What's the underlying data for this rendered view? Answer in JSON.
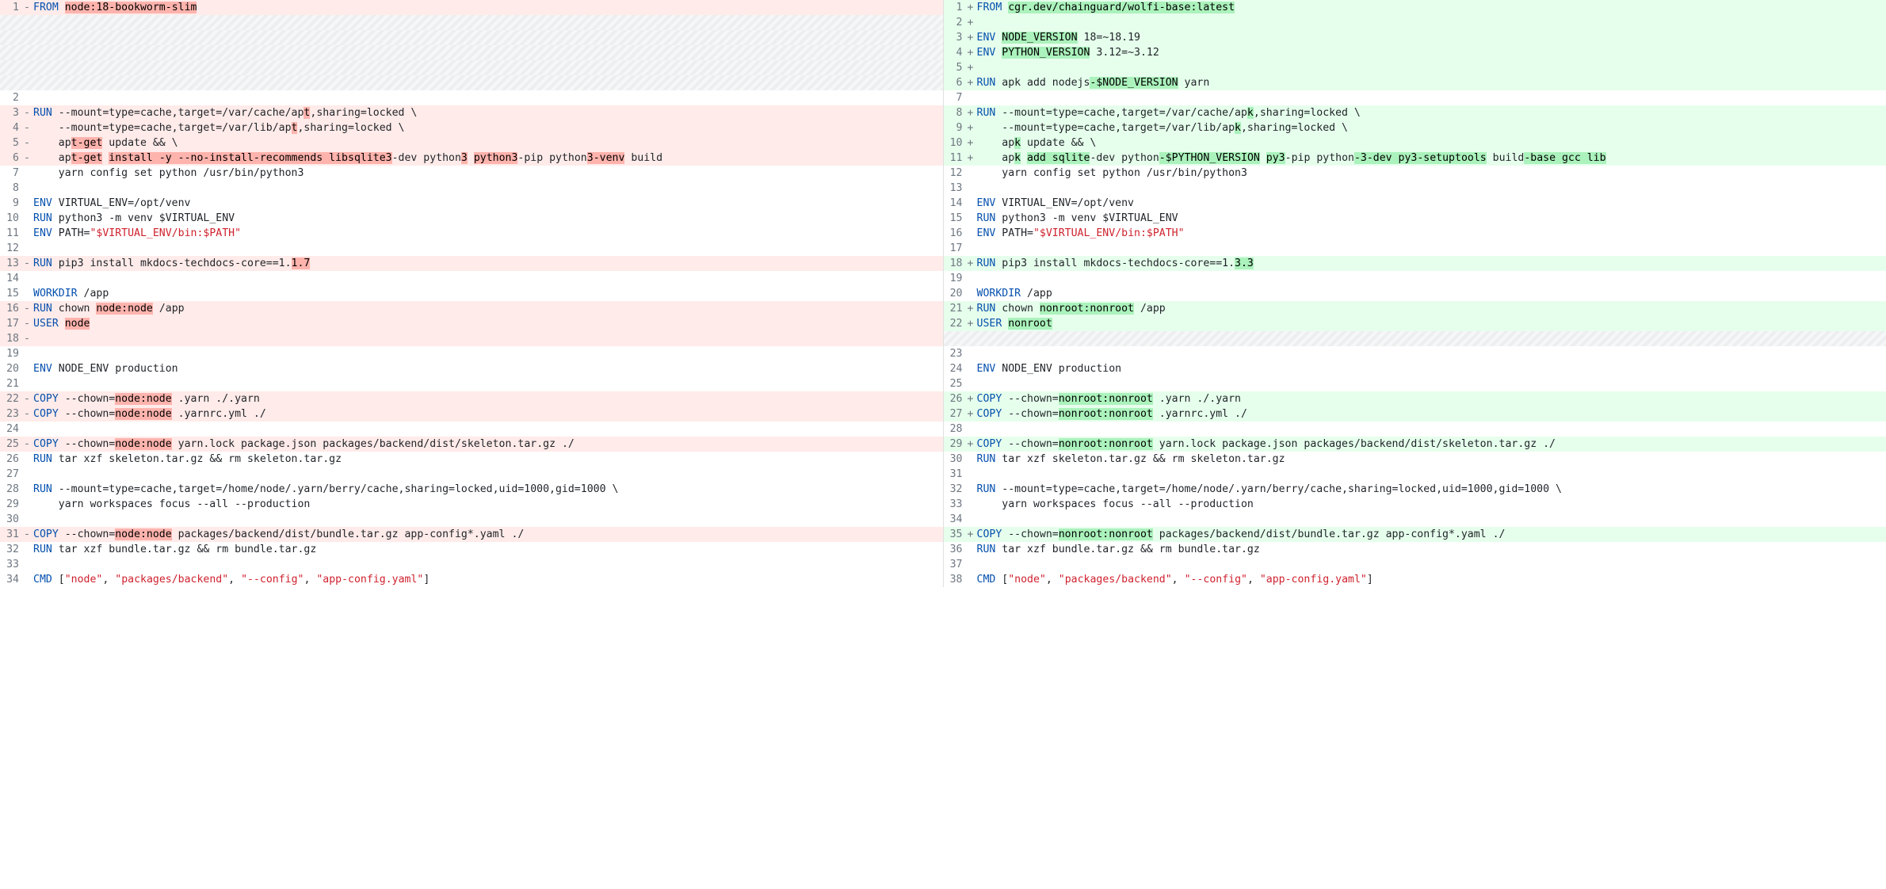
{
  "left": [
    {
      "n": 1,
      "type": "del",
      "tokens": [
        [
          "kw",
          "FROM"
        ],
        [
          "cmd",
          " "
        ],
        [
          "hl-del",
          "node:18-bookworm-slim"
        ]
      ]
    },
    {
      "type": "placeholder"
    },
    {
      "type": "placeholder"
    },
    {
      "type": "placeholder"
    },
    {
      "type": "placeholder"
    },
    {
      "type": "placeholder"
    },
    {
      "n": 2,
      "type": "ctx",
      "tokens": []
    },
    {
      "n": 3,
      "type": "del",
      "tokens": [
        [
          "kw",
          "RUN"
        ],
        [
          "cmd",
          " --mount=type=cache,target=/var/cache/ap"
        ],
        [
          "hl-del",
          "t"
        ],
        [
          "cmd",
          ",sharing=locked \\"
        ]
      ]
    },
    {
      "n": 4,
      "type": "del",
      "tokens": [
        [
          "cmd",
          "    --mount=type=cache,target=/var/lib/ap"
        ],
        [
          "hl-del",
          "t"
        ],
        [
          "cmd",
          ",sharing=locked \\"
        ]
      ]
    },
    {
      "n": 5,
      "type": "del",
      "tokens": [
        [
          "cmd",
          "    ap"
        ],
        [
          "hl-del",
          "t-get"
        ],
        [
          "cmd",
          " update && \\"
        ]
      ]
    },
    {
      "n": 6,
      "type": "del",
      "tokens": [
        [
          "cmd",
          "    ap"
        ],
        [
          "hl-del",
          "t-get"
        ],
        [
          "cmd",
          " "
        ],
        [
          "hl-del",
          "install -y --no-install-recommends libsqlite3"
        ],
        [
          "cmd",
          "-dev python"
        ],
        [
          "hl-del",
          "3"
        ],
        [
          "cmd",
          " "
        ],
        [
          "hl-del",
          "python3"
        ],
        [
          "cmd",
          "-pip python"
        ],
        [
          "hl-del",
          "3-venv"
        ],
        [
          "cmd",
          " build"
        ]
      ]
    },
    {
      "n": 7,
      "type": "ctx",
      "tokens": [
        [
          "cmd",
          "    yarn config set python /usr/bin/python3"
        ]
      ]
    },
    {
      "n": 8,
      "type": "ctx",
      "tokens": []
    },
    {
      "n": 9,
      "type": "ctx",
      "tokens": [
        [
          "kw",
          "ENV"
        ],
        [
          "cmd",
          " VIRTUAL_ENV=/opt/venv"
        ]
      ]
    },
    {
      "n": 10,
      "type": "ctx",
      "tokens": [
        [
          "kw",
          "RUN"
        ],
        [
          "cmd",
          " python3 -m venv $VIRTUAL_ENV"
        ]
      ]
    },
    {
      "n": 11,
      "type": "ctx",
      "tokens": [
        [
          "kw",
          "ENV"
        ],
        [
          "cmd",
          " PATH="
        ],
        [
          "str",
          "\"$VIRTUAL_ENV"
        ],
        [
          "str",
          "/bin:"
        ],
        [
          "str",
          "$PATH\""
        ]
      ]
    },
    {
      "n": 12,
      "type": "ctx",
      "tokens": []
    },
    {
      "n": 13,
      "type": "del",
      "tokens": [
        [
          "kw",
          "RUN"
        ],
        [
          "cmd",
          " pip3 install mkdocs-techdocs-core==1."
        ],
        [
          "hl-del",
          "1.7"
        ]
      ]
    },
    {
      "n": 14,
      "type": "ctx",
      "tokens": []
    },
    {
      "n": 15,
      "type": "ctx",
      "tokens": [
        [
          "kw",
          "WORKDIR"
        ],
        [
          "cmd",
          " /app"
        ]
      ]
    },
    {
      "n": 16,
      "type": "del",
      "tokens": [
        [
          "kw",
          "RUN"
        ],
        [
          "cmd",
          " chown "
        ],
        [
          "hl-del",
          "node:node"
        ],
        [
          "cmd",
          " /app"
        ]
      ]
    },
    {
      "n": 17,
      "type": "del",
      "tokens": [
        [
          "kw",
          "USER"
        ],
        [
          "cmd",
          " "
        ],
        [
          "hl-del",
          "node"
        ]
      ]
    },
    {
      "n": 18,
      "type": "del",
      "tokens": []
    },
    {
      "n": 19,
      "type": "ctx",
      "tokens": []
    },
    {
      "n": 20,
      "type": "ctx",
      "tokens": [
        [
          "kw",
          "ENV"
        ],
        [
          "cmd",
          " NODE_ENV production"
        ]
      ]
    },
    {
      "n": 21,
      "type": "ctx",
      "tokens": []
    },
    {
      "n": 22,
      "type": "del",
      "tokens": [
        [
          "kw",
          "COPY"
        ],
        [
          "cmd",
          " --chown="
        ],
        [
          "hl-del",
          "node:node"
        ],
        [
          "cmd",
          " .yarn ./.yarn"
        ]
      ]
    },
    {
      "n": 23,
      "type": "del",
      "tokens": [
        [
          "kw",
          "COPY"
        ],
        [
          "cmd",
          " --chown="
        ],
        [
          "hl-del",
          "node:node"
        ],
        [
          "cmd",
          " .yarnrc.yml ./"
        ]
      ]
    },
    {
      "n": 24,
      "type": "ctx",
      "tokens": []
    },
    {
      "n": 25,
      "type": "del",
      "tokens": [
        [
          "kw",
          "COPY"
        ],
        [
          "cmd",
          " --chown="
        ],
        [
          "hl-del",
          "node:node"
        ],
        [
          "cmd",
          " yarn.lock package.json packages/backend/dist/skeleton.tar.gz ./"
        ]
      ]
    },
    {
      "n": 26,
      "type": "ctx",
      "tokens": [
        [
          "kw",
          "RUN"
        ],
        [
          "cmd",
          " tar xzf skeleton.tar.gz && rm skeleton.tar.gz"
        ]
      ]
    },
    {
      "n": 27,
      "type": "ctx",
      "tokens": []
    },
    {
      "n": 28,
      "type": "ctx",
      "tokens": [
        [
          "kw",
          "RUN"
        ],
        [
          "cmd",
          " --mount=type=cache,target=/home/node/.yarn/berry/cache,sharing=locked,uid=1000,gid=1000 \\"
        ]
      ]
    },
    {
      "n": 29,
      "type": "ctx",
      "tokens": [
        [
          "cmd",
          "    yarn workspaces focus --all --production"
        ]
      ]
    },
    {
      "n": 30,
      "type": "ctx",
      "tokens": []
    },
    {
      "n": 31,
      "type": "del",
      "tokens": [
        [
          "kw",
          "COPY"
        ],
        [
          "cmd",
          " --chown="
        ],
        [
          "hl-del",
          "node:node"
        ],
        [
          "cmd",
          " packages/backend/dist/bundle.tar.gz app-config*.yaml ./"
        ]
      ]
    },
    {
      "n": 32,
      "type": "ctx",
      "tokens": [
        [
          "kw",
          "RUN"
        ],
        [
          "cmd",
          " tar xzf bundle.tar.gz && rm bundle.tar.gz"
        ]
      ]
    },
    {
      "n": 33,
      "type": "ctx",
      "tokens": []
    },
    {
      "n": 34,
      "type": "ctx",
      "tokens": [
        [
          "kw",
          "CMD"
        ],
        [
          "cmd",
          " ["
        ],
        [
          "str",
          "\"node\""
        ],
        [
          "cmd",
          ", "
        ],
        [
          "str",
          "\"packages/backend\""
        ],
        [
          "cmd",
          ", "
        ],
        [
          "str",
          "\"--config\""
        ],
        [
          "cmd",
          ", "
        ],
        [
          "str",
          "\"app-config.yaml\""
        ],
        [
          "cmd",
          "]"
        ]
      ]
    }
  ],
  "right": [
    {
      "n": 1,
      "type": "add",
      "tokens": [
        [
          "kw",
          "FROM"
        ],
        [
          "cmd",
          " "
        ],
        [
          "hl-add",
          "cgr.dev/chainguard/wolfi-base:latest"
        ]
      ]
    },
    {
      "n": 2,
      "type": "add",
      "tokens": []
    },
    {
      "n": 3,
      "type": "add",
      "tokens": [
        [
          "kw",
          "ENV"
        ],
        [
          "cmd",
          " "
        ],
        [
          "hl-add",
          "NODE_VERSION"
        ],
        [
          "cmd",
          " 18=~18.19"
        ]
      ]
    },
    {
      "n": 4,
      "type": "add",
      "tokens": [
        [
          "kw",
          "ENV"
        ],
        [
          "cmd",
          " "
        ],
        [
          "hl-add",
          "PYTHON_VERSION"
        ],
        [
          "cmd",
          " 3.12=~3.12"
        ]
      ]
    },
    {
      "n": 5,
      "type": "add",
      "tokens": []
    },
    {
      "n": 6,
      "type": "add",
      "tokens": [
        [
          "kw",
          "RUN"
        ],
        [
          "cmd",
          " apk add nodejs"
        ],
        [
          "hl-add",
          "-$NODE_VERSION"
        ],
        [
          "cmd",
          " yarn"
        ]
      ]
    },
    {
      "n": 7,
      "type": "ctx",
      "tokens": []
    },
    {
      "n": 8,
      "type": "add",
      "tokens": [
        [
          "kw",
          "RUN"
        ],
        [
          "cmd",
          " --mount=type=cache,target=/var/cache/ap"
        ],
        [
          "hl-add",
          "k"
        ],
        [
          "cmd",
          ",sharing=locked \\"
        ]
      ]
    },
    {
      "n": 9,
      "type": "add",
      "tokens": [
        [
          "cmd",
          "    --mount=type=cache,target=/var/lib/ap"
        ],
        [
          "hl-add",
          "k"
        ],
        [
          "cmd",
          ",sharing=locked \\"
        ]
      ]
    },
    {
      "n": 10,
      "type": "add",
      "tokens": [
        [
          "cmd",
          "    ap"
        ],
        [
          "hl-add",
          "k"
        ],
        [
          "cmd",
          " update && \\"
        ]
      ]
    },
    {
      "n": 11,
      "type": "add",
      "tokens": [
        [
          "cmd",
          "    ap"
        ],
        [
          "hl-add",
          "k"
        ],
        [
          "cmd",
          " "
        ],
        [
          "hl-add",
          "add sqlite"
        ],
        [
          "cmd",
          "-dev python"
        ],
        [
          "hl-add",
          "-$PYTHON_VERSION"
        ],
        [
          "cmd",
          " "
        ],
        [
          "hl-add",
          "py3"
        ],
        [
          "cmd",
          "-pip python"
        ],
        [
          "hl-add",
          "-3-dev py3-setuptools"
        ],
        [
          "cmd",
          " build"
        ],
        [
          "hl-add",
          "-base gcc lib"
        ]
      ]
    },
    {
      "n": 12,
      "type": "ctx",
      "tokens": [
        [
          "cmd",
          "    yarn config set python /usr/bin/python3"
        ]
      ]
    },
    {
      "n": 13,
      "type": "ctx",
      "tokens": []
    },
    {
      "n": 14,
      "type": "ctx",
      "tokens": [
        [
          "kw",
          "ENV"
        ],
        [
          "cmd",
          " VIRTUAL_ENV=/opt/venv"
        ]
      ]
    },
    {
      "n": 15,
      "type": "ctx",
      "tokens": [
        [
          "kw",
          "RUN"
        ],
        [
          "cmd",
          " python3 -m venv $VIRTUAL_ENV"
        ]
      ]
    },
    {
      "n": 16,
      "type": "ctx",
      "tokens": [
        [
          "kw",
          "ENV"
        ],
        [
          "cmd",
          " PATH="
        ],
        [
          "str",
          "\"$VIRTUAL_ENV"
        ],
        [
          "str",
          "/bin:"
        ],
        [
          "str",
          "$PATH\""
        ]
      ]
    },
    {
      "n": 17,
      "type": "ctx",
      "tokens": []
    },
    {
      "n": 18,
      "type": "add",
      "tokens": [
        [
          "kw",
          "RUN"
        ],
        [
          "cmd",
          " pip3 install mkdocs-techdocs-core==1."
        ],
        [
          "hl-add",
          "3.3"
        ]
      ]
    },
    {
      "n": 19,
      "type": "ctx",
      "tokens": []
    },
    {
      "n": 20,
      "type": "ctx",
      "tokens": [
        [
          "kw",
          "WORKDIR"
        ],
        [
          "cmd",
          " /app"
        ]
      ]
    },
    {
      "n": 21,
      "type": "add",
      "tokens": [
        [
          "kw",
          "RUN"
        ],
        [
          "cmd",
          " chown "
        ],
        [
          "hl-add",
          "nonroot:nonroot"
        ],
        [
          "cmd",
          " /app"
        ]
      ]
    },
    {
      "n": 22,
      "type": "add",
      "tokens": [
        [
          "kw",
          "USER"
        ],
        [
          "cmd",
          " "
        ],
        [
          "hl-add",
          "nonroot"
        ]
      ]
    },
    {
      "type": "placeholder"
    },
    {
      "n": 23,
      "type": "ctx",
      "tokens": []
    },
    {
      "n": 24,
      "type": "ctx",
      "tokens": [
        [
          "kw",
          "ENV"
        ],
        [
          "cmd",
          " NODE_ENV production"
        ]
      ]
    },
    {
      "n": 25,
      "type": "ctx",
      "tokens": []
    },
    {
      "n": 26,
      "type": "add",
      "tokens": [
        [
          "kw",
          "COPY"
        ],
        [
          "cmd",
          " --chown="
        ],
        [
          "hl-add",
          "nonroot:nonroot"
        ],
        [
          "cmd",
          " .yarn ./.yarn"
        ]
      ]
    },
    {
      "n": 27,
      "type": "add",
      "tokens": [
        [
          "kw",
          "COPY"
        ],
        [
          "cmd",
          " --chown="
        ],
        [
          "hl-add",
          "nonroot:nonroot"
        ],
        [
          "cmd",
          " .yarnrc.yml ./"
        ]
      ]
    },
    {
      "n": 28,
      "type": "ctx",
      "tokens": []
    },
    {
      "n": 29,
      "type": "add",
      "tokens": [
        [
          "kw",
          "COPY"
        ],
        [
          "cmd",
          " --chown="
        ],
        [
          "hl-add",
          "nonroot:nonroot"
        ],
        [
          "cmd",
          " yarn.lock package.json packages/backend/dist/skeleton.tar.gz ./"
        ]
      ]
    },
    {
      "n": 30,
      "type": "ctx",
      "tokens": [
        [
          "kw",
          "RUN"
        ],
        [
          "cmd",
          " tar xzf skeleton.tar.gz && rm skeleton.tar.gz"
        ]
      ]
    },
    {
      "n": 31,
      "type": "ctx",
      "tokens": []
    },
    {
      "n": 32,
      "type": "ctx",
      "tokens": [
        [
          "kw",
          "RUN"
        ],
        [
          "cmd",
          " --mount=type=cache,target=/home/node/.yarn/berry/cache,sharing=locked,uid=1000,gid=1000 \\"
        ]
      ]
    },
    {
      "n": 33,
      "type": "ctx",
      "tokens": [
        [
          "cmd",
          "    yarn workspaces focus --all --production"
        ]
      ]
    },
    {
      "n": 34,
      "type": "ctx",
      "tokens": []
    },
    {
      "n": 35,
      "type": "add",
      "tokens": [
        [
          "kw",
          "COPY"
        ],
        [
          "cmd",
          " --chown="
        ],
        [
          "hl-add",
          "nonroot:nonroot"
        ],
        [
          "cmd",
          " packages/backend/dist/bundle.tar.gz app-config*.yaml ./"
        ]
      ]
    },
    {
      "n": 36,
      "type": "ctx",
      "tokens": [
        [
          "kw",
          "RUN"
        ],
        [
          "cmd",
          " tar xzf bundle.tar.gz && rm bundle.tar.gz"
        ]
      ]
    },
    {
      "n": 37,
      "type": "ctx",
      "tokens": []
    },
    {
      "n": 38,
      "type": "ctx",
      "tokens": [
        [
          "kw",
          "CMD"
        ],
        [
          "cmd",
          " ["
        ],
        [
          "str",
          "\"node\""
        ],
        [
          "cmd",
          ", "
        ],
        [
          "str",
          "\"packages/backend\""
        ],
        [
          "cmd",
          ", "
        ],
        [
          "str",
          "\"--config\""
        ],
        [
          "cmd",
          ", "
        ],
        [
          "str",
          "\"app-config.yaml\""
        ],
        [
          "cmd",
          "]"
        ]
      ]
    }
  ],
  "markers": {
    "del": "-",
    "add": "+",
    "ctx": " "
  }
}
